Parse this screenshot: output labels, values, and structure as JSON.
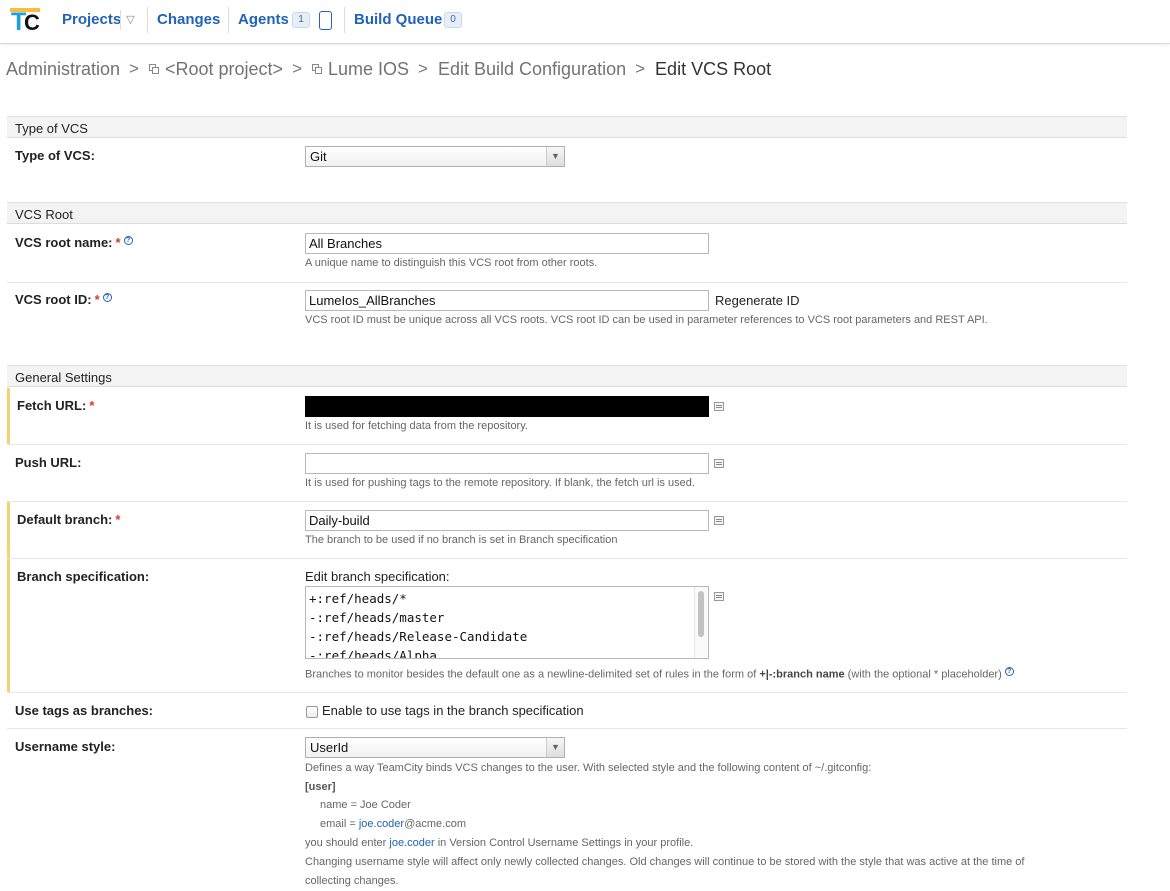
{
  "topbar": {
    "projects": "Projects",
    "changes": "Changes",
    "agents": "Agents",
    "agents_count": "1",
    "build_queue": "Build Queue",
    "build_queue_count": "0"
  },
  "breadcrumb": {
    "administration": "Administration",
    "root_project": "<Root project>",
    "project": "Lume IOS",
    "edit_build_config": "Edit Build Configuration",
    "current": "Edit VCS Root"
  },
  "sections": {
    "type_of_vcs": "Type of VCS",
    "vcs_root": "VCS Root",
    "general_settings": "General Settings"
  },
  "fields": {
    "type_of_vcs": {
      "label": "Type of VCS:",
      "value": "Git"
    },
    "vcs_root_name": {
      "label": "VCS root name:",
      "value": "All Branches",
      "note": "A unique name to distinguish this VCS root from other roots."
    },
    "vcs_root_id": {
      "label": "VCS root ID:",
      "value": "LumeIos_AllBranches",
      "action": "Regenerate ID",
      "note": "VCS root ID must be unique across all VCS roots. VCS root ID can be used in parameter references to VCS root parameters and REST API."
    },
    "fetch_url": {
      "label": "Fetch URL:",
      "value": "",
      "note": "It is used for fetching data from the repository."
    },
    "push_url": {
      "label": "Push URL:",
      "value": "",
      "note": "It is used for pushing tags to the remote repository. If blank, the fetch url is used."
    },
    "default_branch": {
      "label": "Default branch:",
      "value": "Daily-build",
      "note": "The branch to be used if no branch is set in Branch specification"
    },
    "branch_spec": {
      "label": "Branch specification:",
      "edit_label": "Edit branch specification:",
      "lines": [
        "+:ref/heads/*",
        "-:ref/heads/master",
        "-:ref/heads/Release-Candidate",
        "-:ref/heads/Alpha"
      ],
      "note_pre": "Branches to monitor besides the default one as a newline-delimited set of rules in the form of ",
      "note_bold": "+|-:branch name",
      "note_post": " (with the optional * placeholder)"
    },
    "use_tags": {
      "label": "Use tags as branches:",
      "checkbox_label": "Enable to use tags in the branch specification",
      "checked": false
    },
    "username_style": {
      "label": "Username style:",
      "value": "UserId",
      "note1": "Defines a way TeamCity binds VCS changes to the user. With selected style and the following content of ~/.gitconfig:",
      "user_block": "[user]",
      "name_line": "name = Joe Coder",
      "email_pre": "email = ",
      "email_link": "joe.coder",
      "email_post": "@acme.com",
      "enter_pre": "you should enter ",
      "enter_link": "joe.coder",
      "enter_post": " in Version Control Username Settings in your profile.",
      "note2": "Changing username style will affect only newly collected changes. Old changes will continue to be stored with the style that was active at the time of",
      "note3": "collecting changes."
    }
  },
  "colors": {
    "link": "#2163b8",
    "required": "#d33",
    "highlight_bar": "#f4d36e",
    "section_bg": "#f3f3f3"
  }
}
